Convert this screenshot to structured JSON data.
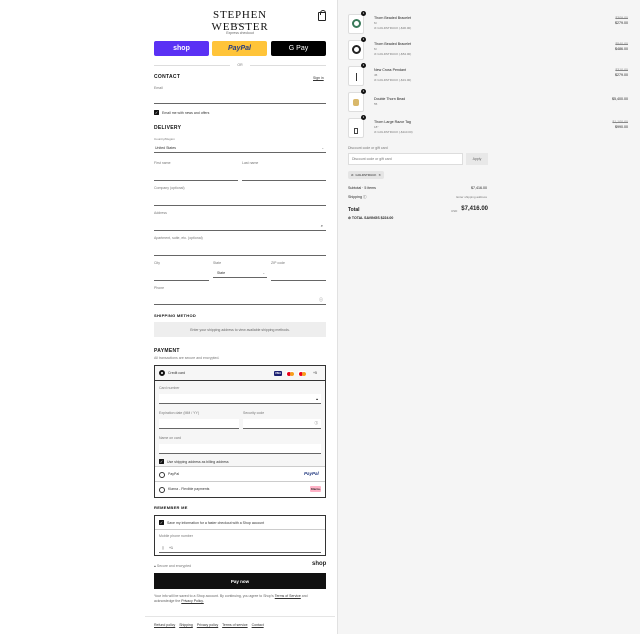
{
  "brand": {
    "name": "STEPHEN WEBSTER",
    "location": "LONDON"
  },
  "express": {
    "label": "Express checkout",
    "shop": "shop",
    "paypal": "PayPal",
    "gpay": "G Pay",
    "or": "OR"
  },
  "contact": {
    "title": "CONTACT",
    "sign_in": "Sign in",
    "email_placeholder": "Email",
    "news_label": "Email me with news and offers"
  },
  "delivery": {
    "title": "DELIVERY",
    "country_label": "Country/Region",
    "country_value": "United States",
    "first_name": "First name",
    "last_name": "Last name",
    "company": "Company (optional)",
    "address": "Address",
    "apartment": "Apartment, suite, etc. (optional)",
    "city": "City",
    "state_label": "State",
    "state_value": "State",
    "zip": "ZIP code",
    "phone": "Phone"
  },
  "shipping": {
    "title": "SHIPPING METHOD",
    "notice": "Enter your shipping address to view available shipping methods."
  },
  "payment": {
    "title": "PAYMENT",
    "subtitle": "All transactions are secure and encrypted.",
    "credit_card": "Credit card",
    "more_cards": "+5",
    "card_number": "Card number",
    "expiry": "Expiration date (MM / YY)",
    "security": "Security code",
    "name_on_card": "Name on card",
    "billing_same": "Use shipping address as billing address",
    "paypal": "PayPal",
    "paypal_logo": "PayPal",
    "klarna": "Klarna - Flexible payments",
    "klarna_logo": "Klarna."
  },
  "remember": {
    "title": "REMEMBER ME",
    "save_label": "Save my information for a faster checkout with a Shop account",
    "phone_label": "Mobile phone number",
    "phone_prefix": "+1"
  },
  "secure": {
    "label": "Secure and encrypted",
    "shop": "shop"
  },
  "pay_now": "Pay now",
  "legal": {
    "text": "Your info will be saved to a Shop account. By continuing, you agree to Shop's",
    "terms": "Terms of Service",
    "and": "and acknowledge the",
    "privacy": "Privacy Policy."
  },
  "footer": [
    "Refund policy",
    "Shipping",
    "Privacy policy",
    "Terms of service",
    "Contact"
  ],
  "cart": {
    "items": [
      {
        "name": "Thorn Beaded Bracelet",
        "variant": "M",
        "discount": "GOLDSTRUCK (-$30.00)",
        "old_price": "$309.00",
        "price": "$279.00",
        "qty": "1"
      },
      {
        "name": "Thorn Beaded Bracelet",
        "variant": "M",
        "discount": "GOLDSTRUCK (-$54.00)",
        "old_price": "$540.00",
        "price": "$486.00",
        "qty": "1"
      },
      {
        "name": "New Cross Pendant",
        "variant": "45",
        "discount": "GOLDSTRUCK (-$31.00)",
        "old_price": "$310.00",
        "price": "$279.00",
        "qty": "1"
      },
      {
        "name": "Double Thorn Bead",
        "variant": "55",
        "discount": "",
        "old_price": "",
        "price": "$5,400.00",
        "qty": "1"
      },
      {
        "name": "Thorn Large Razor Tag",
        "variant": "18\"",
        "discount": "GOLDSTRUCK (-$110.00)",
        "old_price": "$1,100.00",
        "price": "$990.00",
        "qty": "1"
      }
    ],
    "discount_placeholder": "Discount code or gift card",
    "discount_label": "Discount code or gift card",
    "apply": "Apply",
    "applied_code": "GOLDSTRUCK",
    "subtotal_label": "Subtotal · 5 items",
    "subtotal": "$7,416.00",
    "shipping_label": "Shipping",
    "shipping_value": "Enter shipping address",
    "total_label": "Total",
    "currency": "USD",
    "total": "$7,416.00",
    "savings_label": "TOTAL SAVINGS",
    "savings": "$224.00"
  },
  "colors": {
    "shop": "#5a31f4",
    "paypal": "#ffc439",
    "gpay": "#000000",
    "accent": "#111111"
  }
}
